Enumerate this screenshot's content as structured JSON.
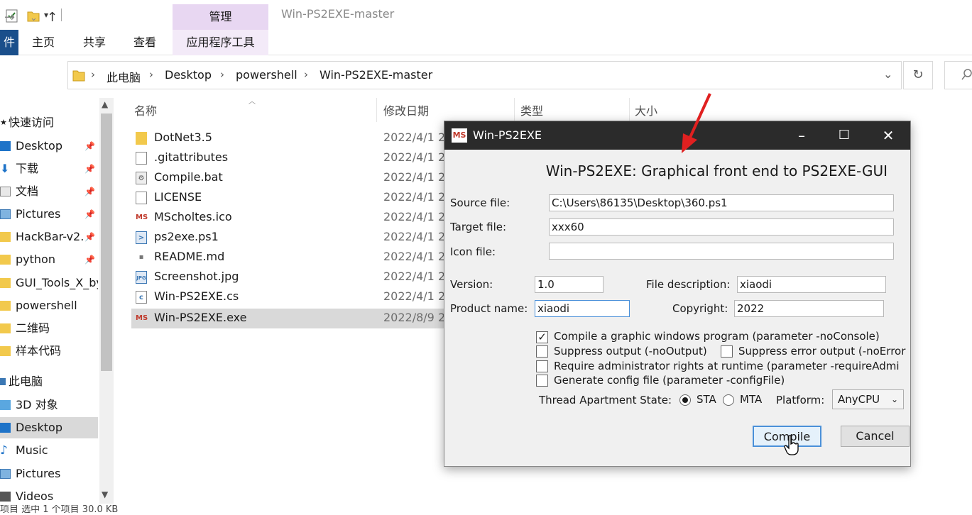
{
  "titlebar": {
    "manage_tab": "管理",
    "window_title": "Win-PS2EXE-master"
  },
  "ribbon": {
    "file_tab": "件",
    "tabs": [
      "主页",
      "共享",
      "查看",
      "应用程序工具"
    ]
  },
  "address": {
    "crumbs": [
      "此电脑",
      "Desktop",
      "powershell",
      "Win-PS2EXE-master"
    ]
  },
  "sidebar": {
    "quick_access": "快速访问",
    "items": [
      {
        "label": "Desktop",
        "icon": "desktop-icon",
        "pinned": true
      },
      {
        "label": "下载",
        "icon": "download-icon",
        "pinned": true
      },
      {
        "label": "文档",
        "icon": "document-icon",
        "pinned": true
      },
      {
        "label": "Pictures",
        "icon": "pictures-icon",
        "pinned": true
      },
      {
        "label": "HackBar-v2.",
        "icon": "folder-icon",
        "pinned": true
      },
      {
        "label": "python",
        "icon": "folder-icon",
        "pinned": true
      },
      {
        "label": "GUI_Tools_X_by",
        "icon": "folder-icon",
        "pinned": false
      },
      {
        "label": "powershell",
        "icon": "folder-icon",
        "pinned": false
      },
      {
        "label": "二维码",
        "icon": "folder-icon",
        "pinned": false
      },
      {
        "label": "样本代码",
        "icon": "folder-icon",
        "pinned": false
      }
    ],
    "this_pc": "此电脑",
    "pc_items": [
      {
        "label": "3D 对象",
        "icon": "3d-objects-icon"
      },
      {
        "label": "Desktop",
        "icon": "desktop-icon"
      },
      {
        "label": "Music",
        "icon": "music-icon"
      },
      {
        "label": "Pictures",
        "icon": "pictures-icon"
      },
      {
        "label": "Videos",
        "icon": "videos-icon"
      }
    ]
  },
  "columns": {
    "name": "名称",
    "date": "修改日期",
    "type": "类型",
    "size": "大小"
  },
  "files": [
    {
      "name": "DotNet3.5",
      "date": "2022/4/1 2",
      "icon": "folder-icon"
    },
    {
      "name": ".gitattributes",
      "date": "2022/4/1 2",
      "icon": "file-icon"
    },
    {
      "name": "Compile.bat",
      "date": "2022/4/1 2",
      "icon": "bat-icon"
    },
    {
      "name": "LICENSE",
      "date": "2022/4/1 2",
      "icon": "file-icon"
    },
    {
      "name": "MScholtes.ico",
      "date": "2022/4/1 2",
      "icon": "ms-icon"
    },
    {
      "name": "ps2exe.ps1",
      "date": "2022/4/1 2",
      "icon": "ps1-icon"
    },
    {
      "name": "README.md",
      "date": "2022/4/1 2",
      "icon": "md-icon"
    },
    {
      "name": "Screenshot.jpg",
      "date": "2022/4/1 2",
      "icon": "jpg-icon"
    },
    {
      "name": "Win-PS2EXE.cs",
      "date": "2022/4/1 2",
      "icon": "cs-icon"
    },
    {
      "name": "Win-PS2EXE.exe",
      "date": "2022/8/9 2",
      "icon": "ms-icon"
    }
  ],
  "status": "项目    选中 1 个项目  30.0 KB",
  "dialog": {
    "title": "Win-PS2EXE",
    "heading": "Win-PS2EXE: Graphical front end to PS2EXE-GUI",
    "source_label": "Source file:",
    "source_value": "C:\\Users\\86135\\Desktop\\360.ps1",
    "target_label": "Target file:",
    "target_value": "xxx60",
    "icon_label": "Icon file:",
    "icon_value": "",
    "version_label": "Version:",
    "version_value": "1.0",
    "filedesc_label": "File description:",
    "filedesc_value": "xiaodi",
    "product_label": "Product name:",
    "product_value": "xiaodi",
    "copyright_label": "Copyright:",
    "copyright_value": "2022",
    "chk_noconsole": {
      "label": "Compile a graphic windows program (parameter -noConsole)",
      "checked": true
    },
    "chk_nooutput": {
      "label": "Suppress output (-noOutput)",
      "checked": false
    },
    "chk_noerror": {
      "label": "Suppress error output (-noError",
      "checked": false
    },
    "chk_admin": {
      "label": "Require administrator rights at runtime (parameter -requireAdmi",
      "checked": false
    },
    "chk_config": {
      "label": "Generate config file (parameter -configFile)",
      "checked": false
    },
    "apartment_label": "Thread Apartment State:",
    "sta_label": "STA",
    "mta_label": "MTA",
    "apartment_selected": "STA",
    "platform_label": "Platform:",
    "platform_value": "AnyCPU",
    "compile_label": "Compile",
    "cancel_label": "Cancel"
  },
  "colors": {
    "file_tab": "#1a4f8b",
    "manage_tab": "#e8d7f2",
    "dialog_titlebar": "#2b2b2b",
    "annotation_arrow": "#e02020"
  }
}
